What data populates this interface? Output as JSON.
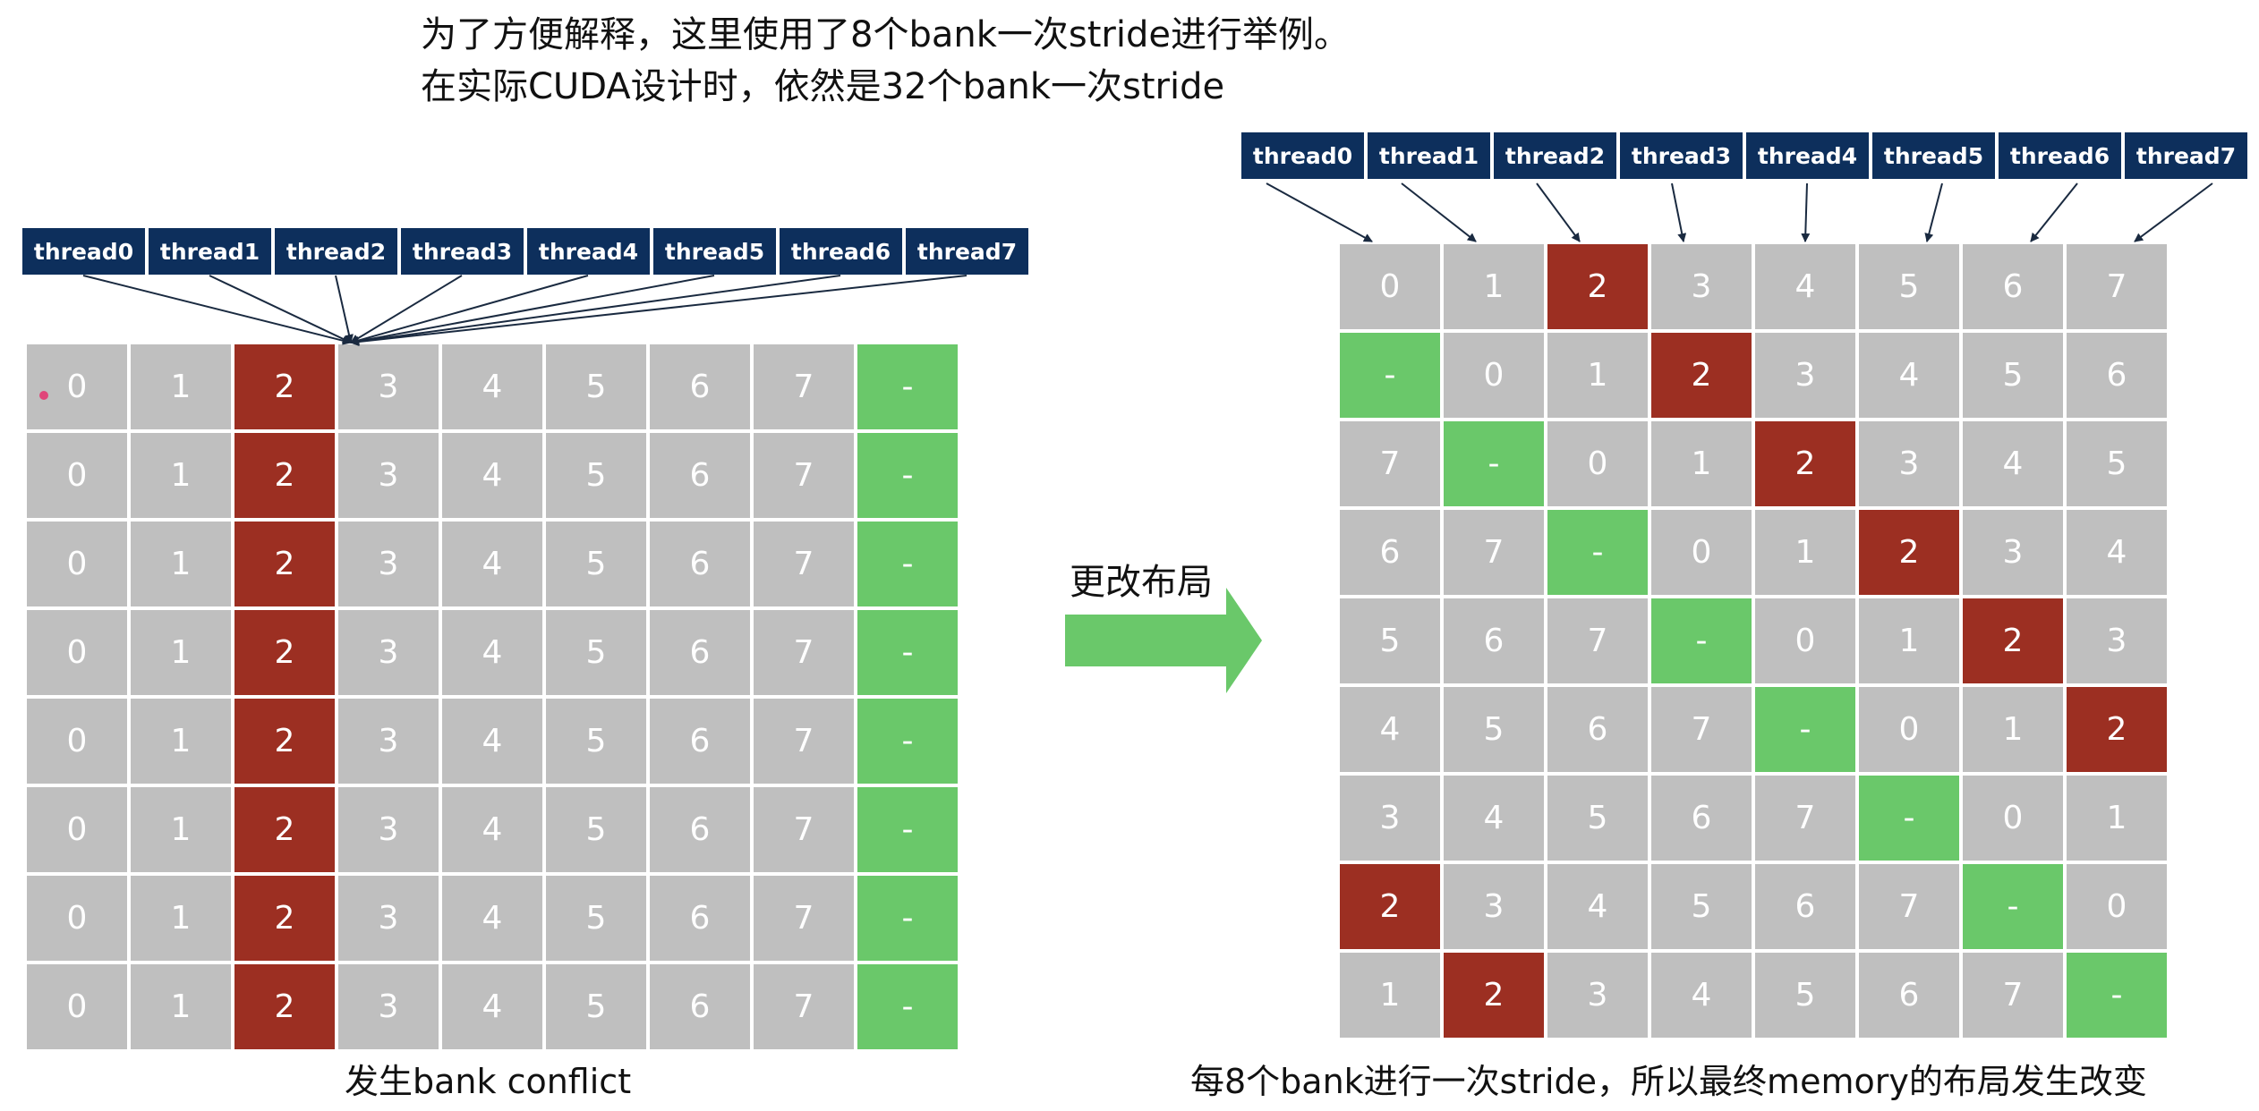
{
  "intro": {
    "line1": "为了方便解释，这里使用了8个bank一次stride进行举例。",
    "line2": "在实际CUDA设计时，依然是32个bank一次stride"
  },
  "threads": [
    "thread0",
    "thread1",
    "thread2",
    "thread3",
    "thread4",
    "thread5",
    "thread6",
    "thread7"
  ],
  "left": {
    "caption": "发生bank conflict",
    "rows": [
      [
        "0",
        "1",
        "2",
        "3",
        "4",
        "5",
        "6",
        "7",
        "-"
      ],
      [
        "0",
        "1",
        "2",
        "3",
        "4",
        "5",
        "6",
        "7",
        "-"
      ],
      [
        "0",
        "1",
        "2",
        "3",
        "4",
        "5",
        "6",
        "7",
        "-"
      ],
      [
        "0",
        "1",
        "2",
        "3",
        "4",
        "5",
        "6",
        "7",
        "-"
      ],
      [
        "0",
        "1",
        "2",
        "3",
        "4",
        "5",
        "6",
        "7",
        "-"
      ],
      [
        "0",
        "1",
        "2",
        "3",
        "4",
        "5",
        "6",
        "7",
        "-"
      ],
      [
        "0",
        "1",
        "2",
        "3",
        "4",
        "5",
        "6",
        "7",
        "-"
      ],
      [
        "0",
        "1",
        "2",
        "3",
        "4",
        "5",
        "6",
        "7",
        "-"
      ]
    ]
  },
  "transition": {
    "label": "更改布局"
  },
  "right": {
    "caption": "每8个bank进行一次stride，所以最终memory的布局发生改变",
    "rows": [
      [
        "0",
        "1",
        "2",
        "3",
        "4",
        "5",
        "6",
        "7"
      ],
      [
        "-",
        "0",
        "1",
        "2",
        "3",
        "4",
        "5",
        "6"
      ],
      [
        "7",
        "-",
        "0",
        "1",
        "2",
        "3",
        "4",
        "5"
      ],
      [
        "6",
        "7",
        "-",
        "0",
        "1",
        "2",
        "3",
        "4"
      ],
      [
        "5",
        "6",
        "7",
        "-",
        "0",
        "1",
        "2",
        "3"
      ],
      [
        "4",
        "5",
        "6",
        "7",
        "-",
        "0",
        "1",
        "2"
      ],
      [
        "3",
        "4",
        "5",
        "6",
        "7",
        "-",
        "0",
        "1"
      ],
      [
        "2",
        "3",
        "4",
        "5",
        "6",
        "7",
        "-",
        "0"
      ],
      [
        "1",
        "2",
        "3",
        "4",
        "5",
        "6",
        "7",
        "-"
      ]
    ]
  },
  "colors": {
    "thread_bg": "#0d2f5c",
    "cell_bg": "#bfbfbf",
    "conflict_cell": "#9c2f22",
    "padding_cell": "#6ac86a",
    "arrow": "#6ac86a"
  }
}
